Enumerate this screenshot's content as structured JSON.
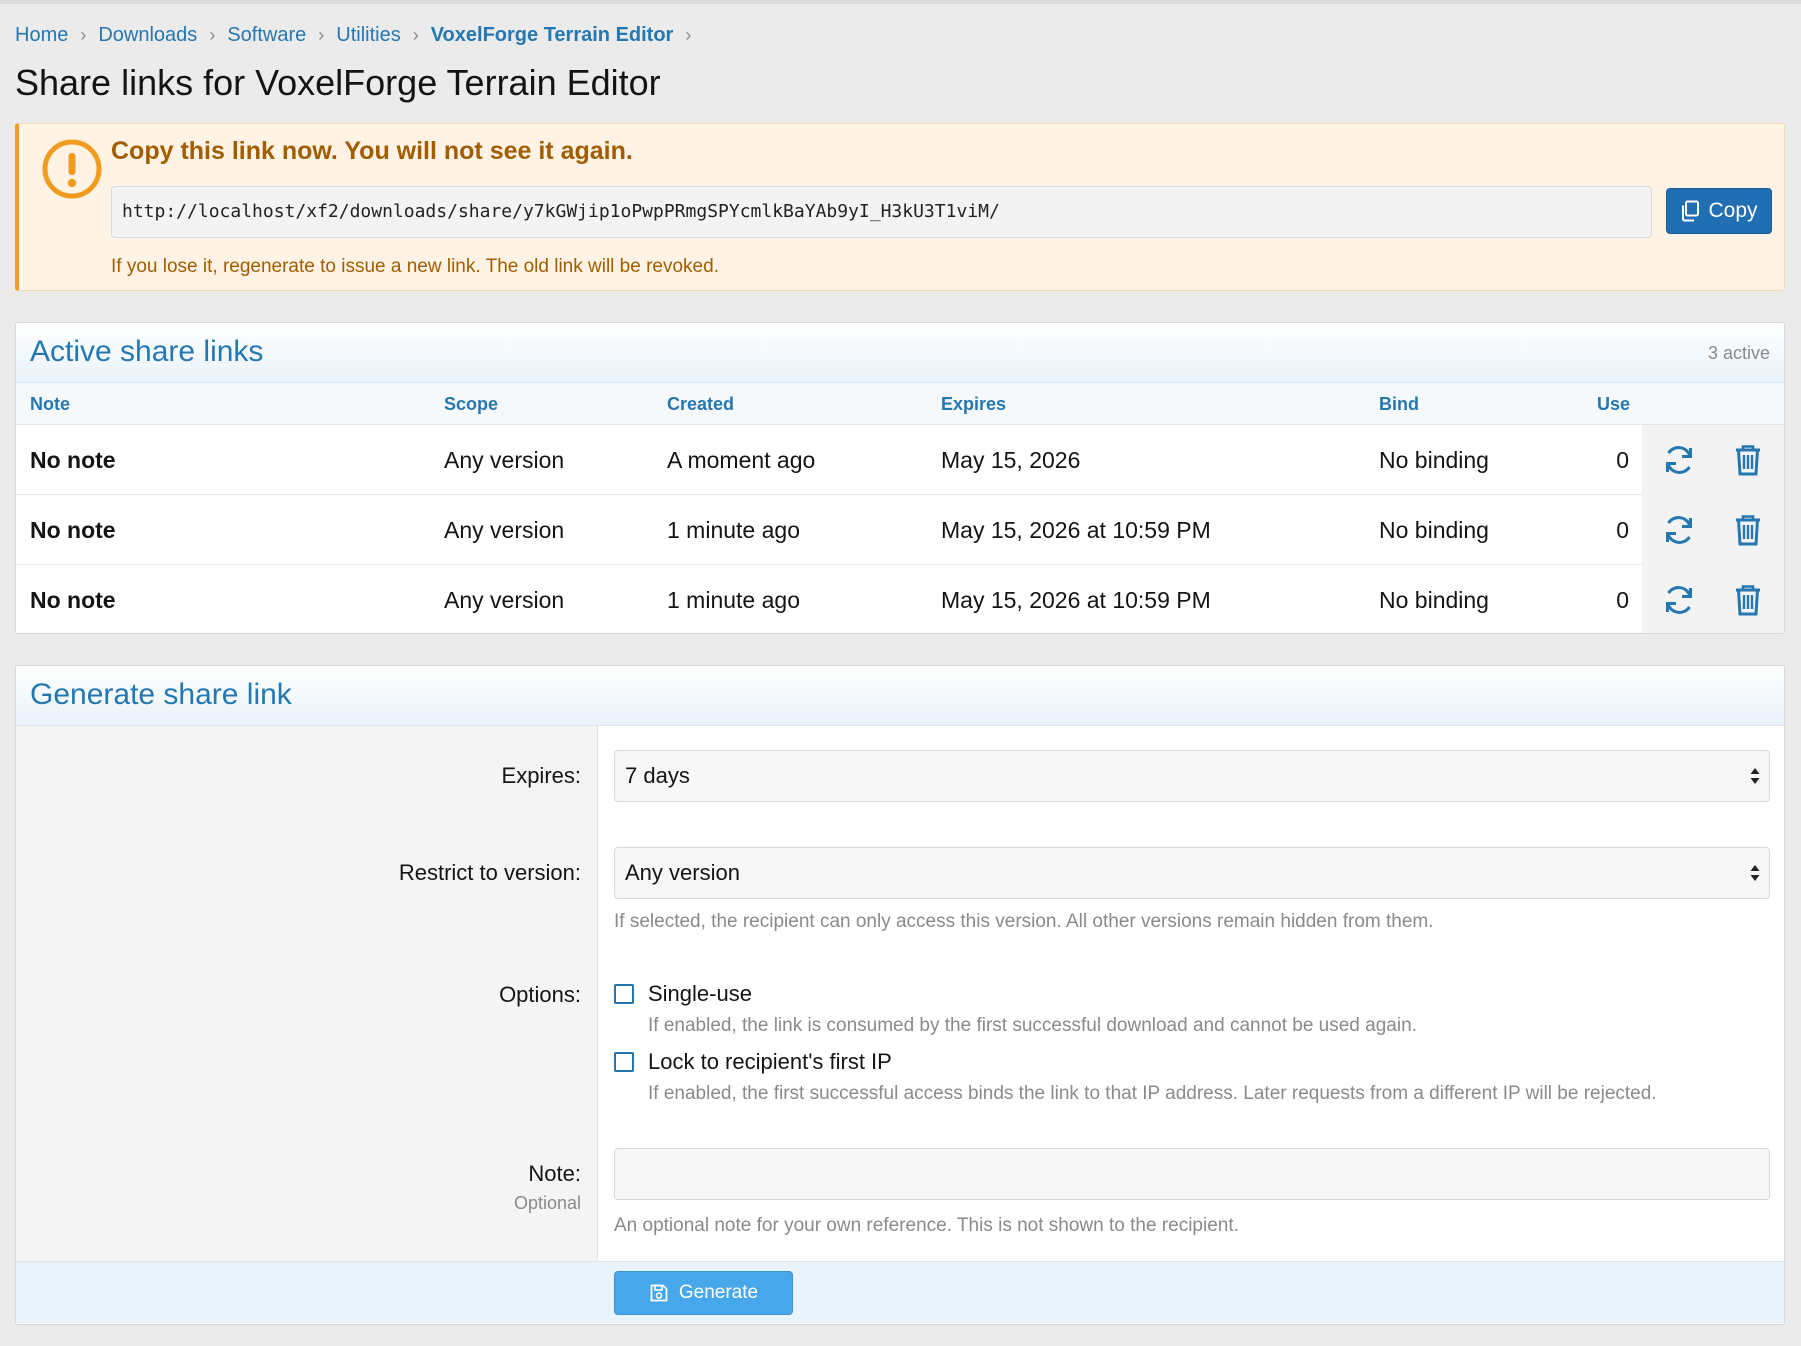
{
  "breadcrumb": [
    {
      "label": "Home"
    },
    {
      "label": "Downloads"
    },
    {
      "label": "Software"
    },
    {
      "label": "Utilities"
    },
    {
      "label": "VoxelForge Terrain Editor"
    }
  ],
  "page_title": "Share links for VoxelForge Terrain Editor",
  "alert": {
    "title": "Copy this link now. You will not see it again.",
    "link": "http://localhost/xf2/downloads/share/y7kGWjip1oPwpPRmgSPYcmlkBaYAb9yI_H3kU3T1viM/",
    "copy_label": "Copy",
    "note": "If you lose it, regenerate to issue a new link. The old link will be revoked.",
    "icon": "exclamation-circle-icon",
    "accent_color": "#f19b1f"
  },
  "active_links": {
    "title": "Active share links",
    "count_label": "3 active",
    "columns": [
      "Note",
      "Scope",
      "Created",
      "Expires",
      "Bind",
      "Use"
    ],
    "rows": [
      {
        "note": "No note",
        "scope": "Any version",
        "created": "A moment ago",
        "expires": "May 15, 2026",
        "bind": "No binding",
        "use": "0"
      },
      {
        "note": "No note",
        "scope": "Any version",
        "created": "1 minute ago",
        "expires": "May 15, 2026 at 10:59 PM",
        "bind": "No binding",
        "use": "0"
      },
      {
        "note": "No note",
        "scope": "Any version",
        "created": "1 minute ago",
        "expires": "May 15, 2026 at 10:59 PM",
        "bind": "No binding",
        "use": "0"
      }
    ],
    "row_actions": [
      "regenerate-icon",
      "trash-icon"
    ]
  },
  "generate": {
    "title": "Generate share link",
    "expires_label": "Expires:",
    "expires_value": "7 days",
    "version_label": "Restrict to version:",
    "version_value": "Any version",
    "version_hint": "If selected, the recipient can only access this version. All other versions remain hidden from them.",
    "options_label": "Options:",
    "single_use_label": "Single-use",
    "single_use_hint": "If enabled, the link is consumed by the first successful download and cannot be used again.",
    "lock_ip_label": "Lock to recipient's first IP",
    "lock_ip_hint": "If enabled, the first successful access binds the link to that IP address. Later requests from a different IP will be rejected.",
    "note_label": "Note:",
    "note_optional": "Optional",
    "note_value": "",
    "note_hint": "An optional note for your own reference. This is not shown to the recipient.",
    "generate_label": "Generate"
  },
  "colors": {
    "link": "#2577b1",
    "primary_button": "#1f6fb2",
    "generate_button": "#47a7eb",
    "warning_text": "#a25d00"
  }
}
